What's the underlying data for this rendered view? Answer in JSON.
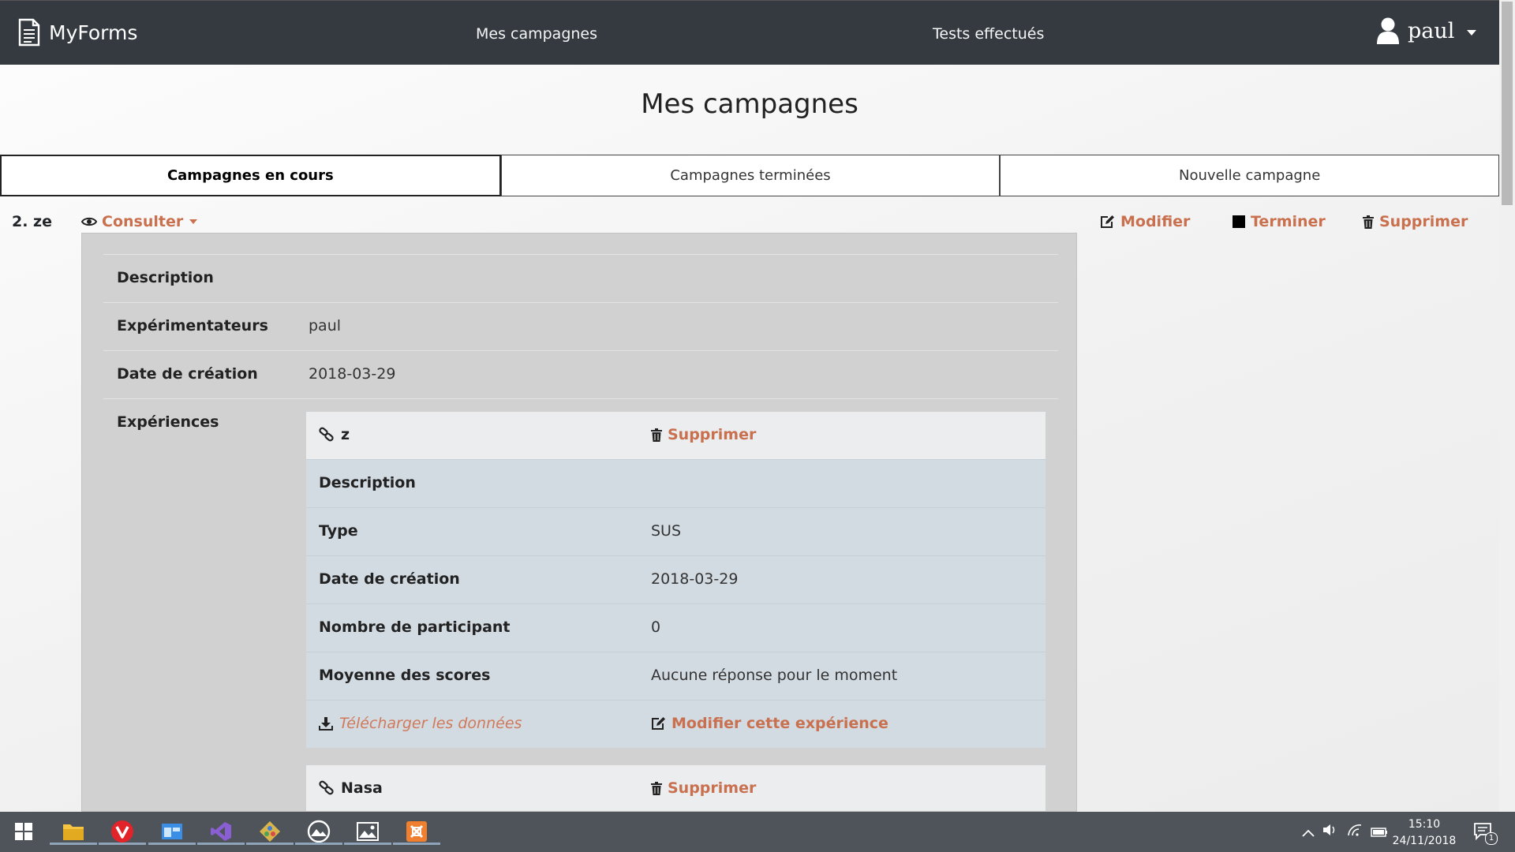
{
  "navbar": {
    "brand": "MyForms",
    "links": [
      "Mes campagnes",
      "Tests effectués"
    ],
    "user": "paul"
  },
  "page": {
    "title": "Mes campagnes"
  },
  "tabs": [
    "Campagnes en cours",
    "Campagnes terminées",
    "Nouvelle campagne"
  ],
  "campaign": {
    "name": "2. ze",
    "consult_label": "Consulter",
    "actions": {
      "edit": "Modifier",
      "finish": "Terminer",
      "delete": "Supprimer"
    },
    "details": [
      {
        "label": "Description",
        "value": ""
      },
      {
        "label": "Expérimentateurs",
        "value": "paul"
      },
      {
        "label": "Date de création",
        "value": "2018-03-29"
      },
      {
        "label": "Expériences",
        "value": ""
      }
    ],
    "experiences": [
      {
        "name": "z",
        "delete": "Supprimer",
        "rows": [
          {
            "label": "Description",
            "value": ""
          },
          {
            "label": "Type",
            "value": "SUS"
          },
          {
            "label": "Date de création",
            "value": "2018-03-29"
          },
          {
            "label": "Nombre de participant",
            "value": "0"
          },
          {
            "label": "Moyenne des scores",
            "value": "Aucune réponse pour le moment"
          }
        ],
        "download": "Télécharger les données",
        "edit": "Modifier cette expérience"
      },
      {
        "name": "Nasa",
        "delete": "Supprimer"
      }
    ]
  },
  "taskbar": {
    "time": "15:10",
    "date": "24/11/2018",
    "notifications": "1"
  }
}
